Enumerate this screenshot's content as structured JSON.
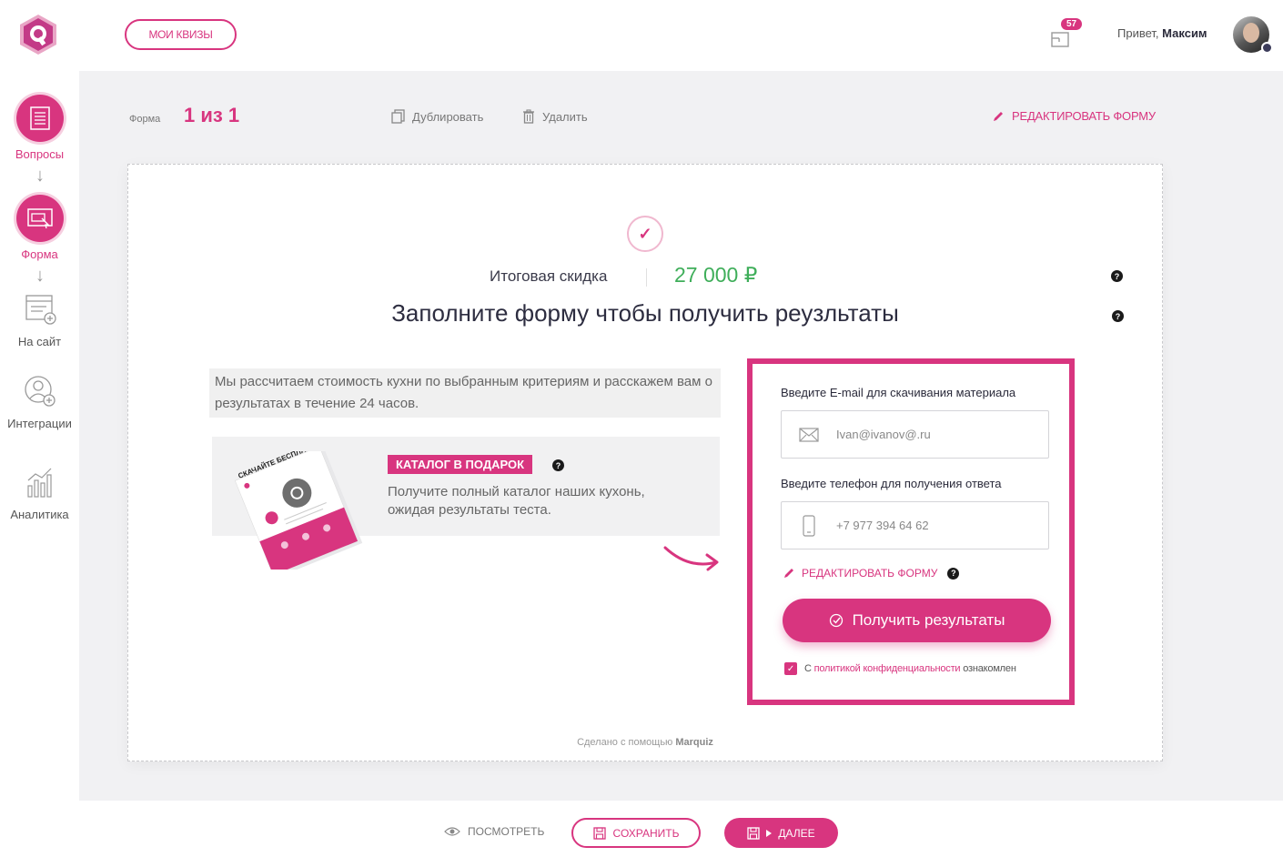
{
  "header": {
    "my_quizzes": "МОИ КВИЗЫ",
    "notifications_count": "57",
    "greeting_prefix": "Привет,",
    "user_name": "Максим"
  },
  "sidebar": {
    "steps": [
      {
        "label": "Вопросы",
        "icon": "questions-list-icon"
      },
      {
        "label": "Форма",
        "icon": "form-screen-icon"
      },
      {
        "label": "На сайт",
        "icon": "site-install-icon"
      },
      {
        "label": "Интеграции",
        "icon": "integrations-icon"
      },
      {
        "label": "Аналитика",
        "icon": "analytics-chart-icon"
      }
    ]
  },
  "toolbar": {
    "form_label": "Форма",
    "form_count": "1 из 1",
    "duplicate": "Дублировать",
    "delete": "Удалить",
    "edit_form": "РЕДАКТИРОВАТЬ ФОРМУ"
  },
  "result": {
    "discount_label": "Итоговая скидка",
    "discount_value": "27 000 ₽",
    "headline": "Заполните форму чтобы получить реузльтаты",
    "description": "Мы рассчитаем стоимость кухни по выбранным критериям и расскажем вам о результатах в течение 24 часов.",
    "gift_badge": "КАТАЛОГ В ПОДАРОК",
    "gift_text": "Получите полный каталог наших кухонь, ожидая результаты теста.",
    "book_cover_text": "СКАЧАЙТЕ БЕСПЛАТНО"
  },
  "lead_form": {
    "email_label": "Введите E-mail для скачивания материала",
    "email_placeholder": "Ivan@ivanov@.ru",
    "phone_label": "Введите телефон для получения ответа",
    "phone_placeholder": "+7 977 394 64 62",
    "edit_form": "РЕДАКТИРОВАТЬ ФОРМУ",
    "submit": "Получить результаты",
    "policy_prefix": "С",
    "policy_link": "политикой конфиденциальности",
    "policy_suffix": "ознакомлен",
    "policy_checked": true
  },
  "footer": {
    "made_with_prefix": "Сделано с помощью",
    "made_with_brand": "Marquiz"
  },
  "bottom": {
    "view": "ПОСМОТРЕТЬ",
    "save": "СОХРАНИТЬ",
    "next": "ДАЛЕЕ"
  },
  "colors": {
    "accent": "#d8357f",
    "discount": "#3fae5a",
    "workspace": "#f1f1f3"
  }
}
